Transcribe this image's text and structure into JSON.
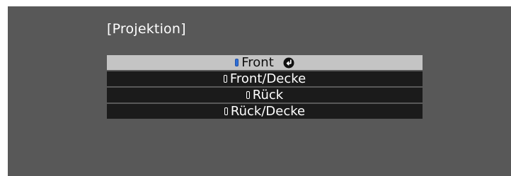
{
  "menu": {
    "title": "[Projektion]",
    "options": [
      {
        "label": "Front",
        "selected": true,
        "icon": "radio-selected-icon",
        "confirm_icon": "enter-icon"
      },
      {
        "label": "Front/Decke",
        "selected": false,
        "icon": "radio-icon"
      },
      {
        "label": "Rück",
        "selected": false,
        "icon": "radio-icon"
      },
      {
        "label": "Rück/Decke",
        "selected": false,
        "icon": "radio-icon"
      }
    ]
  },
  "colors": {
    "screen_background": "#585858",
    "row_background": "#1b1b1b",
    "selected_row_background": "#c4c4c4",
    "selected_radio": "#2f6fd6"
  }
}
